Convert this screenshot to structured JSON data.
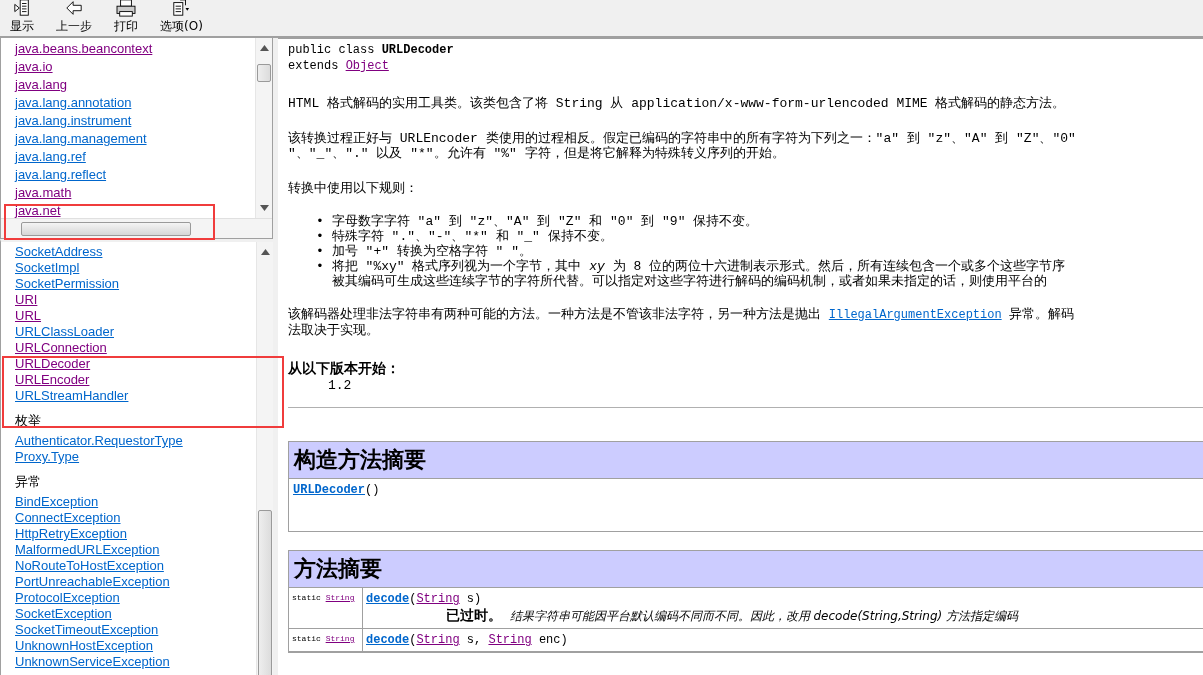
{
  "toolbar": [
    {
      "kind": "show",
      "label": "显示"
    },
    {
      "kind": "back",
      "label": "上一步"
    },
    {
      "kind": "print",
      "label": "打印"
    },
    {
      "kind": "options",
      "label": "选项(O)"
    }
  ],
  "package_list": [
    {
      "text": "java.beans.beancontext",
      "visited": true
    },
    {
      "text": "java.io",
      "visited": true
    },
    {
      "text": "java.lang",
      "visited": true
    },
    {
      "text": "java.lang.annotation",
      "visited": false
    },
    {
      "text": "java.lang.instrument",
      "visited": false
    },
    {
      "text": "java.lang.management",
      "visited": false
    },
    {
      "text": "java.lang.ref",
      "visited": false
    },
    {
      "text": "java.lang.reflect",
      "visited": false
    },
    {
      "text": "java.math",
      "visited": true
    },
    {
      "text": "java.net",
      "visited": true
    }
  ],
  "class_list": [
    {
      "items": [
        {
          "text": "SocketAddress",
          "visited": false
        },
        {
          "text": "SocketImpl",
          "visited": false
        },
        {
          "text": "SocketPermission",
          "visited": false
        },
        {
          "text": "URI",
          "visited": true
        },
        {
          "text": "URL",
          "visited": true
        },
        {
          "text": "URLClassLoader",
          "visited": false
        },
        {
          "text": "URLConnection",
          "visited": true
        },
        {
          "text": "URLDecoder",
          "visited": true
        },
        {
          "text": "URLEncoder",
          "visited": true
        },
        {
          "text": "URLStreamHandler",
          "visited": false
        }
      ]
    },
    {
      "heading": "枚举",
      "items": [
        {
          "text": "Authenticator.RequestorType",
          "visited": false
        },
        {
          "text": "Proxy.Type",
          "visited": false
        }
      ]
    },
    {
      "heading": "异常",
      "items": [
        {
          "text": "BindException",
          "visited": false
        },
        {
          "text": "ConnectException",
          "visited": false
        },
        {
          "text": "HttpRetryException",
          "visited": false
        },
        {
          "text": "MalformedURLException",
          "visited": false
        },
        {
          "text": "NoRouteToHostException",
          "visited": false
        },
        {
          "text": "PortUnreachableException",
          "visited": false
        },
        {
          "text": "ProtocolException",
          "visited": false
        },
        {
          "text": "SocketException",
          "visited": false
        },
        {
          "text": "SocketTimeoutException",
          "visited": false
        },
        {
          "text": "UnknownHostException",
          "visited": false
        },
        {
          "text": "UnknownServiceException",
          "visited": false
        }
      ]
    }
  ],
  "class_header": {
    "declaration": "public class",
    "name": "URLDecoder",
    "extends_label": "extends",
    "superclass": "Object"
  },
  "description": [
    {
      "lines": [
        "HTML 格式解码的实用工具类。该类包含了将 String 从 application/x-www-form-urlencoded MIME 格式解码的静态方法。"
      ]
    },
    {
      "lines": [
        "该转换过程正好与 URLEncoder 类使用的过程相反。假定已编码的字符串中的所有字符为下列之一：\"a\" 到 \"z\"、\"A\" 到 \"Z\"、\"0\"",
        "\"、\"_\"、\".\" 以及 \"*\"。允许有 \"%\" 字符，但是将它解释为特殊转义序列的开始。"
      ]
    },
    {
      "lines": [
        "转换中使用以下规则："
      ]
    }
  ],
  "rules": [
    {
      "marker": "•",
      "lines": [
        "字母数字字符 \"a\" 到 \"z\"、\"A\" 到 \"Z\" 和 \"0\" 到 \"9\" 保持不变。"
      ]
    },
    {
      "marker": "•",
      "lines": [
        "特殊字符 \".\"、\"-\"、\"*\" 和 \"_\" 保持不变。"
      ]
    },
    {
      "marker": "•",
      "lines": [
        "加号 \"+\" 转换为空格字符 \" \"。"
      ]
    },
    {
      "marker": "•",
      "lines": [
        "将把 \"%xy\" 格式序列视为一个字节，其中 *xy* 为 8 位的两位十六进制表示形式。然后，所有连续包含一个或多个这些字节序",
        "被其编码可生成这些连续字节的字符所代替。可以指定对这些字符进行解码的编码机制，或者如果未指定的话，则使用平台的"
      ]
    }
  ],
  "invalid_note": {
    "before": "该解码器处理非法字符串有两种可能的方法。一种方法是不管该非法字符，另一种方法是抛出",
    "link": "IllegalArgumentException",
    "after": "异常。解码",
    "second_line": "法取决于实现。"
  },
  "since": {
    "label": "从以下版本开始：",
    "value": "1.2"
  },
  "constructor_summary": {
    "title": "构造方法摘要",
    "rows": [
      {
        "name": "URLDecoder",
        "params": "()"
      }
    ]
  },
  "method_summary": {
    "title": "方法摘要",
    "rows": [
      {
        "modifier": "static",
        "return_type": "String",
        "name": "decode",
        "open": "(",
        "close": ")",
        "params": [
          {
            "type": "String",
            "name": "s"
          }
        ],
        "deprecated_label": "已过时。",
        "note": "结果字符串可能因平台默认编码不同而不同。因此，改用 decode(String,String) 方法指定编码"
      },
      {
        "modifier": "static",
        "return_type": "String",
        "name": "decode",
        "open": "(",
        "close": ")",
        "params": [
          {
            "type": "String",
            "name": "s"
          },
          {
            "separator": ",",
            "type": "String",
            "name": "enc"
          }
        ]
      }
    ]
  },
  "highlights": [
    {
      "kind": "frame"
    },
    {
      "kind": "frame"
    }
  ]
}
